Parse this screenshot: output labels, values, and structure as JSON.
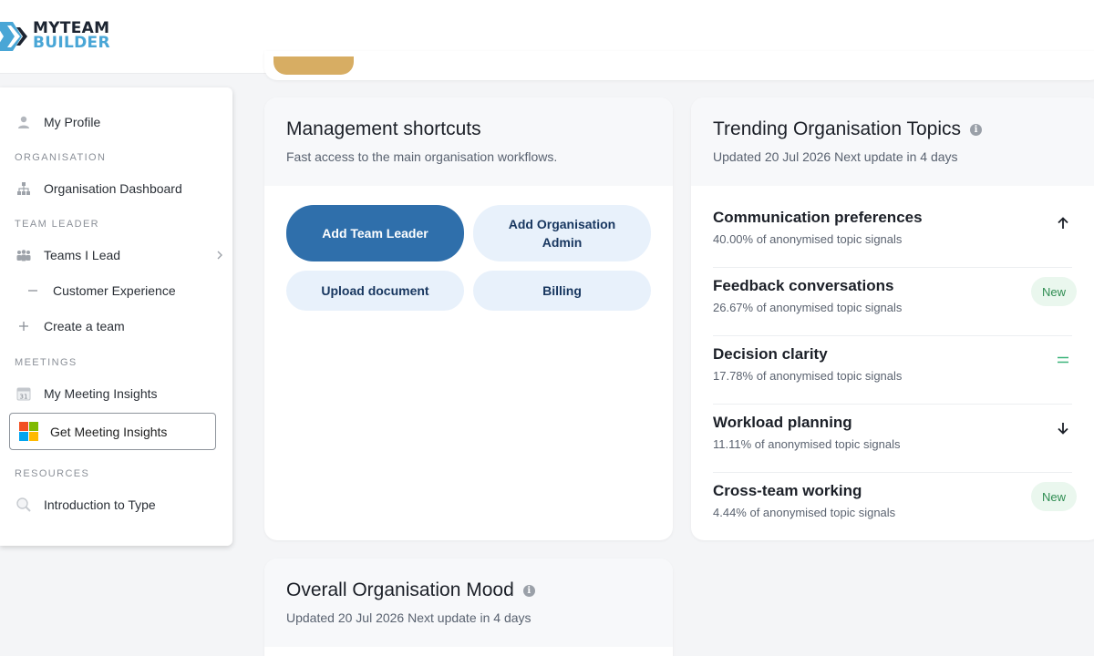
{
  "brand": {
    "line1": "MYTEAM",
    "line2": "BUILDER",
    "accent": "#49a6d6",
    "dark": "#1c2431"
  },
  "sidebar": {
    "my_profile": "My Profile",
    "section_organisation": "ORGANISATION",
    "organisation_dashboard": "Organisation Dashboard",
    "section_team_leader": "TEAM LEADER",
    "teams_i_lead": "Teams I Lead",
    "customer_experience": "Customer Experience",
    "create_team": "Create a team",
    "section_meetings": "MEETINGS",
    "my_meeting_insights": "My Meeting Insights",
    "calendar_day": "31",
    "get_meeting_insights": "Get Meeting Insights",
    "section_resources": "RESOURCES",
    "introduction_to_type": "Introduction to Type"
  },
  "shortcuts": {
    "title": "Management shortcuts",
    "subtitle": "Fast access to the main organisation workflows.",
    "add_team_leader": "Add Team Leader",
    "add_org_admin": "Add Organisation Admin",
    "upload_document": "Upload document",
    "billing": "Billing"
  },
  "trending": {
    "title": "Trending Organisation Topics",
    "subtitle": "Updated 20 Jul 2026 Next update in 4 days",
    "topics": [
      {
        "name": "Communication preferences",
        "desc": "40.00% of anonymised topic signals",
        "trend": "up-arrow-icon"
      },
      {
        "name": "Feedback conversations",
        "desc": "26.67% of anonymised topic signals",
        "badge": "New"
      },
      {
        "name": "Decision clarity",
        "desc": "17.78% of anonymised topic signals",
        "trend": "equals-icon"
      },
      {
        "name": "Workload planning",
        "desc": "11.11% of anonymised topic signals",
        "trend": "down-arrow-icon"
      },
      {
        "name": "Cross-team working",
        "desc": "4.44% of anonymised topic signals",
        "badge": "New"
      }
    ]
  },
  "mood": {
    "title": "Overall Organisation Mood",
    "subtitle": "Updated 20 Jul 2026 Next update in 4 days"
  },
  "colors": {
    "primary": "#2f6fab",
    "secondary": "#e8f1fb",
    "new_badge": "#eaf7ee",
    "equals": "#3bb47a"
  }
}
